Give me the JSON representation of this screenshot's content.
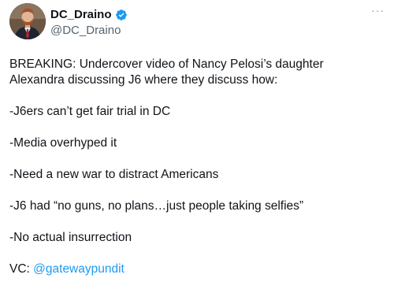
{
  "user": {
    "display_name": "DC_Draino",
    "handle": "@DC_Draino",
    "verified": true
  },
  "menu": {
    "more_label": "···"
  },
  "tweet": {
    "paragraphs": [
      "BREAKING: Undercover video of Nancy Pelosi’s daughter Alexandra discussing J6 where they discuss how:",
      "-J6ers can’t get fair trial in DC",
      "-Media overhyped it",
      "-Need a new war to distract Americans",
      "-J6 had “no guns, no plans…just people taking selfies”",
      "-No actual insurrection"
    ],
    "vc_prefix": "VC: ",
    "vc_mention": "@gatewaypundit"
  },
  "colors": {
    "text": "#0f1419",
    "secondary": "#536471",
    "link": "#1d9bf0",
    "verified": "#1d9bf0"
  },
  "icons": {
    "verified": "verified-badge-icon",
    "more": "more-icon"
  }
}
